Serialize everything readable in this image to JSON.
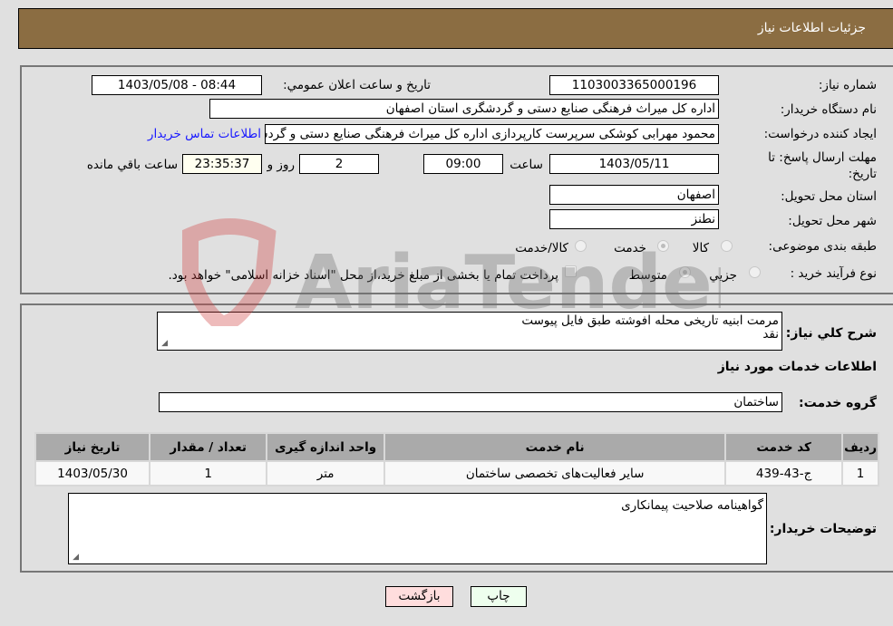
{
  "header": {
    "title": "جزئیات اطلاعات نیاز"
  },
  "fields": {
    "need_number": {
      "label": "شماره نیاز:",
      "value": "1103003365000196"
    },
    "announce_datetime": {
      "label": "تاریخ و ساعت اعلان عمومي:",
      "value": "1403/05/08 - 08:44"
    },
    "buyer_org": {
      "label": "نام دستگاه خریدار:",
      "value": "اداره کل میراث فرهنگی  صنایع دستی و گردشگری استان اصفهان"
    },
    "requester": {
      "label": "ایجاد کننده درخواست:",
      "value": "محمود مهرابی کوشکی سرپرست کارپردازی اداره کل میراث فرهنگی  صنایع دستی و گردشگری استان اصفهان"
    },
    "buyer_contact_link": "اطلاعات تماس خریدار",
    "deadline": {
      "label": "مهلت ارسال پاسخ: تا تاریخ:",
      "date": "1403/05/11",
      "time_label": "ساعت",
      "time": "09:00",
      "days": "2",
      "days_label": "روز و",
      "remaining": "23:35:37",
      "remaining_label": "ساعت باقي مانده"
    },
    "province": {
      "label": "استان محل تحویل:",
      "value": "اصفهان"
    },
    "city": {
      "label": "شهر محل تحویل:",
      "value": "نطنز"
    },
    "category": {
      "label": "طبقه بندی موضوعی:",
      "options": [
        {
          "label": "کالا",
          "checked": false
        },
        {
          "label": "خدمت",
          "checked": true
        },
        {
          "label": "کالا/خدمت",
          "checked": false
        }
      ]
    },
    "purchase_type": {
      "label": "نوع فرآیند خرید :",
      "options": [
        {
          "label": "جزيي",
          "checked": false
        },
        {
          "label": "متوسط",
          "checked": true
        }
      ],
      "treasury_checkbox_label": "پرداخت تمام یا بخشی از مبلغ خرید،از محل \"اسناد خزانه اسلامی\" خواهد بود.",
      "treasury_checked": false
    }
  },
  "description": {
    "label": "شرح کلي نياز:",
    "line1": "مرمت ابنیه تاریخی محله افوشته طبق فایل پیوست",
    "line2": "نقد"
  },
  "services_section_title": "اطلاعات خدمات مورد نياز",
  "service_group": {
    "label": "گروه خدمت:",
    "value": "ساختمان"
  },
  "table": {
    "headers": [
      "ردیف",
      "کد خدمت",
      "نام خدمت",
      "واحد اندازه گیری",
      "تعداد / مقدار",
      "تاریخ نیاز"
    ],
    "rows": [
      [
        "1",
        "ج-43-439",
        "سایر فعالیت‌های تخصصی ساختمان",
        "متر",
        "1",
        "1403/05/30"
      ]
    ]
  },
  "buyer_notes": {
    "label": "توضیحات خریدار:",
    "value": "گواهینامه صلاحیت پیمانکاری"
  },
  "buttons": {
    "print": "چاپ",
    "back": "بازگشت"
  },
  "watermark": {
    "text": "AriaTender.neT"
  },
  "colors": {
    "header_bg": "#8b6d42",
    "print_bg": "#eeffee",
    "back_bg": "#ffdddd",
    "link": "#1a1aff"
  }
}
